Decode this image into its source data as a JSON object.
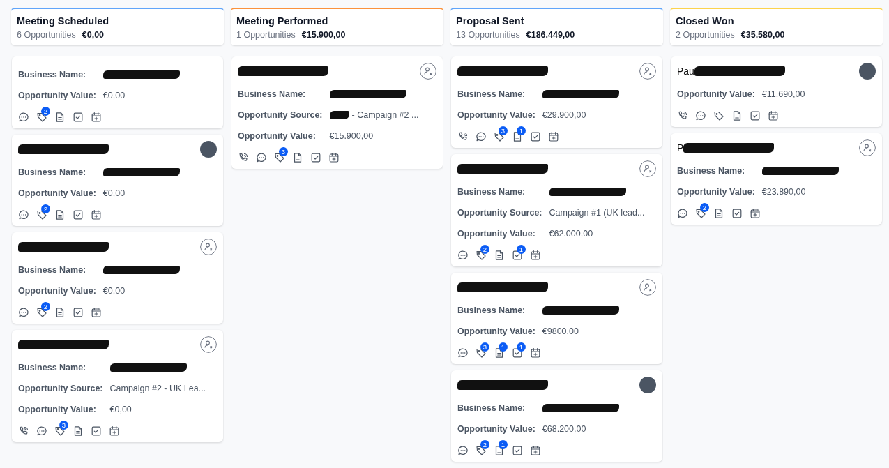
{
  "columns": [
    {
      "title": "Meeting Scheduled",
      "count": "6 Opportunities",
      "total": "€0,00",
      "color": "#60a5fa",
      "cards": [
        {
          "fields": [
            {
              "label": "Business Name:",
              "redacted": true
            },
            {
              "label": "Opportunity Value:",
              "value": "€0,00"
            }
          ],
          "actions": [
            {
              "kind": "chat"
            },
            {
              "kind": "tag",
              "badge": "2"
            },
            {
              "kind": "note"
            },
            {
              "kind": "task"
            },
            {
              "kind": "calendar"
            }
          ]
        },
        {
          "name": {
            "redacted": true
          },
          "photo": true,
          "fields": [
            {
              "label": "Business Name:",
              "redacted": true
            },
            {
              "label": "Opportunity Value:",
              "value": "€0,00"
            }
          ],
          "actions": [
            {
              "kind": "chat"
            },
            {
              "kind": "tag",
              "badge": "2"
            },
            {
              "kind": "note"
            },
            {
              "kind": "task"
            },
            {
              "kind": "calendar"
            }
          ]
        },
        {
          "name": {
            "redacted": true
          },
          "photo": false,
          "fields": [
            {
              "label": "Business Name:",
              "redacted": true
            },
            {
              "label": "Opportunity Value:",
              "value": "€0,00"
            }
          ],
          "actions": [
            {
              "kind": "chat"
            },
            {
              "kind": "tag",
              "badge": "2"
            },
            {
              "kind": "note"
            },
            {
              "kind": "task"
            },
            {
              "kind": "calendar"
            }
          ]
        },
        {
          "name": {
            "redacted": true
          },
          "photo": false,
          "fields": [
            {
              "label": "Business Name:",
              "redacted": true
            },
            {
              "label": "Opportunity Source:",
              "value": "Campaign #2 - UK Lea..."
            },
            {
              "label": "Opportunity Value:",
              "value": "€0,00"
            }
          ],
          "actions": [
            {
              "kind": "call"
            },
            {
              "kind": "chat"
            },
            {
              "kind": "tag",
              "badge": "3"
            },
            {
              "kind": "note"
            },
            {
              "kind": "task"
            },
            {
              "kind": "calendar"
            }
          ]
        }
      ]
    },
    {
      "title": "Meeting Performed",
      "count": "1 Opportunities",
      "total": "€15.900,00",
      "color": "#fb923c",
      "cards": [
        {
          "name": {
            "redacted": true
          },
          "photo": false,
          "fields": [
            {
              "label": "Business Name:",
              "redacted": true
            },
            {
              "label": "Opportunity Source:",
              "value": "- Campaign #2 ...",
              "redacted_start": true
            },
            {
              "label": "Opportunity Value:",
              "value": "€15.900,00"
            }
          ],
          "actions": [
            {
              "kind": "call"
            },
            {
              "kind": "chat"
            },
            {
              "kind": "tag",
              "badge": "3"
            },
            {
              "kind": "note"
            },
            {
              "kind": "task"
            },
            {
              "kind": "calendar"
            }
          ]
        }
      ]
    },
    {
      "title": "Proposal Sent",
      "count": "13 Opportunities",
      "total": "€186.449,00",
      "color": "#60a5fa",
      "cards": [
        {
          "name": {
            "redacted": true
          },
          "photo": false,
          "fields": [
            {
              "label": "Business Name:",
              "redacted": true
            },
            {
              "label": "Opportunity Value:",
              "value": "€29.900,00"
            }
          ],
          "actions": [
            {
              "kind": "call"
            },
            {
              "kind": "chat"
            },
            {
              "kind": "tag",
              "badge": "3"
            },
            {
              "kind": "note",
              "badge": "1"
            },
            {
              "kind": "task"
            },
            {
              "kind": "calendar"
            }
          ]
        },
        {
          "name": {
            "redacted": true
          },
          "photo": false,
          "fields": [
            {
              "label": "Business Name:",
              "redacted": true
            },
            {
              "label": "Opportunity Source:",
              "value": "Campaign #1 (UK lead..."
            },
            {
              "label": "Opportunity Value:",
              "value": "€62.000,00"
            }
          ],
          "actions": [
            {
              "kind": "chat"
            },
            {
              "kind": "tag",
              "badge": "2"
            },
            {
              "kind": "note"
            },
            {
              "kind": "task",
              "badge": "1"
            },
            {
              "kind": "calendar"
            }
          ]
        },
        {
          "name": {
            "redacted": true
          },
          "photo": false,
          "fields": [
            {
              "label": "Business Name:",
              "redacted": true
            },
            {
              "label": "Opportunity Value:",
              "value": "€9800,00"
            }
          ],
          "actions": [
            {
              "kind": "chat"
            },
            {
              "kind": "tag",
              "badge": "3"
            },
            {
              "kind": "note",
              "badge": "1"
            },
            {
              "kind": "task",
              "badge": "1"
            },
            {
              "kind": "calendar"
            }
          ]
        },
        {
          "name": {
            "redacted": true
          },
          "photo": true,
          "fields": [
            {
              "label": "Business Name:",
              "redacted": true
            },
            {
              "label": "Opportunity Value:",
              "value": "€68.200,00"
            }
          ],
          "actions": [
            {
              "kind": "chat"
            },
            {
              "kind": "tag",
              "badge": "2"
            },
            {
              "kind": "note",
              "badge": "1"
            },
            {
              "kind": "task"
            },
            {
              "kind": "calendar"
            }
          ]
        }
      ]
    },
    {
      "title": "Closed Won",
      "count": "2 Opportunities",
      "total": "€35.580,00",
      "color": "#fcd34d",
      "cards": [
        {
          "name": {
            "text": "Pau",
            "redacted": true
          },
          "photo": true,
          "fields": [
            {
              "label": "Opportunity Value:",
              "value": "€11.690,00"
            }
          ],
          "actions": [
            {
              "kind": "call"
            },
            {
              "kind": "chat"
            },
            {
              "kind": "tag"
            },
            {
              "kind": "note"
            },
            {
              "kind": "task"
            },
            {
              "kind": "calendar"
            }
          ]
        },
        {
          "name": {
            "text": "P",
            "redacted": true
          },
          "photo": false,
          "fields": [
            {
              "label": "Business Name:",
              "redacted": true
            },
            {
              "label": "Opportunity Value:",
              "value": "€23.890,00"
            }
          ],
          "actions": [
            {
              "kind": "chat"
            },
            {
              "kind": "tag",
              "badge": "2"
            },
            {
              "kind": "note"
            },
            {
              "kind": "task"
            },
            {
              "kind": "calendar"
            }
          ]
        }
      ]
    }
  ]
}
